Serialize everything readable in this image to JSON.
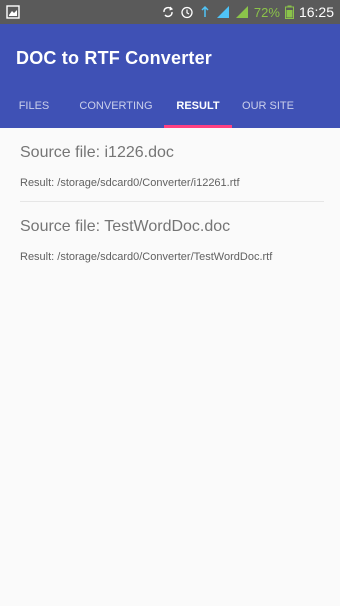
{
  "status_bar": {
    "battery_percent": "72%",
    "time": "16:25",
    "icons": [
      "gallery-icon",
      "sync-icon",
      "alarm-icon",
      "wifi-icon",
      "signal-icon",
      "signal-icon-2",
      "battery-icon"
    ]
  },
  "app": {
    "title": "DOC to RTF Converter",
    "primary_color": "#3f51b5",
    "accent_color": "#ff4081"
  },
  "tabs": [
    {
      "label": "FILES",
      "active": false
    },
    {
      "label": "CONVERTING",
      "active": false
    },
    {
      "label": "RESULT",
      "active": true
    },
    {
      "label": "OUR SITE",
      "active": false
    }
  ],
  "results": [
    {
      "source": "Source file: i1226.doc",
      "result": "Result: /storage/sdcard0/Converter/i12261.rtf"
    },
    {
      "source": "Source file: TestWordDoc.doc",
      "result": "Result: /storage/sdcard0/Converter/TestWordDoc.rtf"
    }
  ]
}
